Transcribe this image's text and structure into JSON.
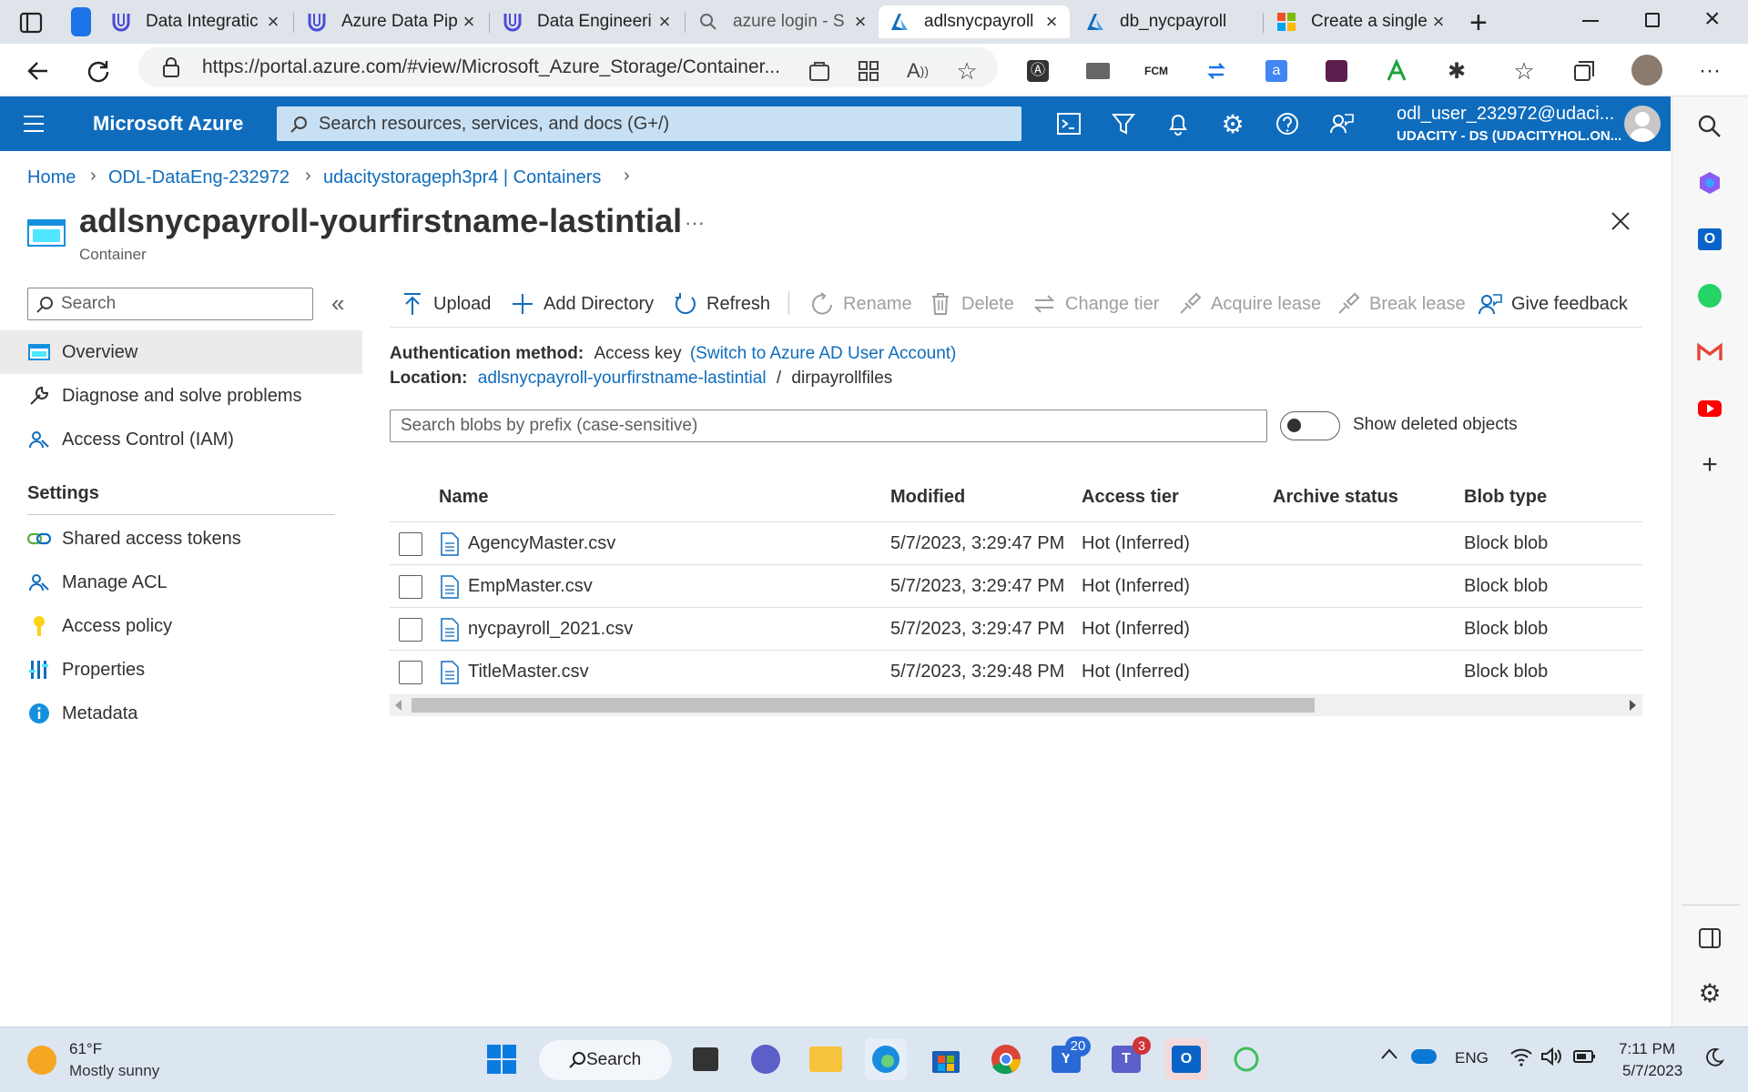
{
  "browser": {
    "tabs": [
      {
        "label": "Data Integratic",
        "icon": "udacity-icon"
      },
      {
        "label": "Azure Data Pip",
        "icon": "udacity-icon"
      },
      {
        "label": "Data Engineeri",
        "icon": "udacity-icon"
      },
      {
        "label": "azure login - S",
        "icon": "search-icon"
      },
      {
        "label": "adlsnycpayroll",
        "icon": "azure-icon"
      },
      {
        "label": "db_nycpayroll",
        "icon": "azure-icon"
      },
      {
        "label": "Create a single",
        "icon": "microsoft-icon"
      }
    ],
    "url": "https://portal.azure.com/#view/Microsoft_Azure_Storage/Container..."
  },
  "azure": {
    "brand": "Microsoft Azure",
    "search_placeholder": "Search resources, services, and docs (G+/)",
    "user_name": "odl_user_232972@udaci...",
    "user_tenant": "UDACITY - DS (UDACITYHOL.ON..."
  },
  "breadcrumb": [
    "Home",
    "ODL-DataEng-232972",
    "udacitystorageph3pr4 | Containers"
  ],
  "page": {
    "title": "adlsnycpayroll-yourfirstname-lastintial",
    "subtitle": "Container",
    "more": "···"
  },
  "leftnav": {
    "search_placeholder": "Search",
    "collapse": "«",
    "items": [
      "Overview",
      "Diagnose and solve problems",
      "Access Control (IAM)"
    ],
    "settings_heading": "Settings",
    "settings_items": [
      "Shared access tokens",
      "Manage ACL",
      "Access policy",
      "Properties",
      "Metadata"
    ]
  },
  "toolbar": {
    "upload": "Upload",
    "add_directory": "Add Directory",
    "refresh": "Refresh",
    "rename": "Rename",
    "delete": "Delete",
    "change_tier": "Change tier",
    "acquire_lease": "Acquire lease",
    "break_lease": "Break lease",
    "give_feedback": "Give feedback"
  },
  "info": {
    "auth_label": "Authentication method:",
    "auth_value": "Access key",
    "auth_switch": "(Switch to Azure AD User Account)",
    "location_label": "Location:",
    "location_link": "adlsnycpayroll-yourfirstname-lastintial",
    "location_sep": "/",
    "location_folder": "dirpayrollfiles"
  },
  "filter": {
    "placeholder": "Search blobs by prefix (case-sensitive)",
    "show_deleted": "Show deleted objects"
  },
  "table": {
    "columns": [
      "Name",
      "Modified",
      "Access tier",
      "Archive status",
      "Blob type"
    ],
    "rows": [
      {
        "name": "AgencyMaster.csv",
        "modified": "5/7/2023, 3:29:47 PM",
        "tier": "Hot (Inferred)",
        "archive": "",
        "type": "Block blob"
      },
      {
        "name": "EmpMaster.csv",
        "modified": "5/7/2023, 3:29:47 PM",
        "tier": "Hot (Inferred)",
        "archive": "",
        "type": "Block blob"
      },
      {
        "name": "nycpayroll_2021.csv",
        "modified": "5/7/2023, 3:29:47 PM",
        "tier": "Hot (Inferred)",
        "archive": "",
        "type": "Block blob"
      },
      {
        "name": "TitleMaster.csv",
        "modified": "5/7/2023, 3:29:48 PM",
        "tier": "Hot (Inferred)",
        "archive": "",
        "type": "Block blob"
      }
    ]
  },
  "taskbar": {
    "weather_temp": "61°F",
    "weather_desc": "Mostly sunny",
    "search_label": "Search",
    "badge_mail": "20",
    "badge_teams": "3",
    "lang": "ENG",
    "time": "7:11 PM",
    "date": "5/7/2023"
  },
  "colors": {
    "azure_blue": "#0f6cbd",
    "link": "#0f6cbd",
    "tabstrip": "#dfe4ea"
  }
}
